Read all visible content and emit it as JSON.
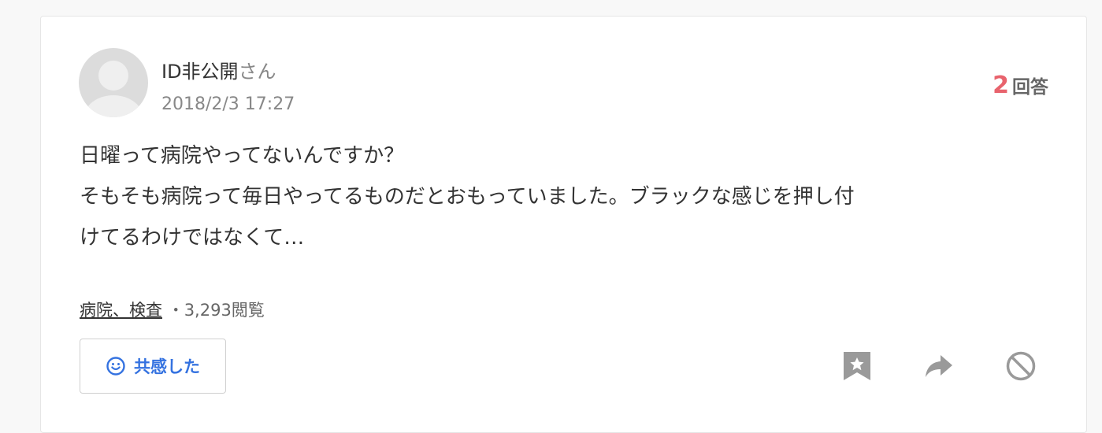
{
  "question": {
    "username": "ID非公開",
    "username_suffix": "さん",
    "timestamp": "2018/2/3 17:27",
    "answer_count": "2",
    "answer_label": "回答",
    "body_lines": [
      "日曜って病院やってないんですか？",
      "そもそも病院って毎日やってるものだとおもっていました。ブラックな感じを押し付",
      "けてるわけではなくて…"
    ],
    "tags": "病院、検査",
    "separator": "・",
    "views": "3,293閲覧"
  },
  "actions": {
    "empathy_label": "共感した",
    "empathy_icon": "smiley-icon",
    "bookmark_icon": "bookmark-star-icon",
    "share_icon": "share-arrow-icon",
    "report_icon": "prohibited-icon"
  },
  "colors": {
    "accent_blue": "#3472e0",
    "answer_count_red": "#e8636d",
    "icon_gray": "#9a9a9a"
  }
}
